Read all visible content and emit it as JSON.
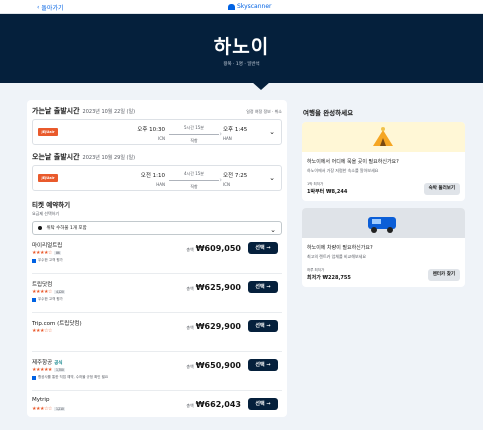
{
  "header": {
    "back_label": "돌아가기",
    "brand": "Skyscanner"
  },
  "hero": {
    "title": "하노이",
    "subtitle": "왕복 · 1명 · 일반석"
  },
  "outbound": {
    "title": "가는날 출발시간",
    "date": "2023년 10월 22일 (일)",
    "note": "일정 여정 정보 · 취소",
    "airline": "JEJUair",
    "dep_time": "오후 10:30",
    "dep_code": "ICN",
    "duration": "5시간 15분",
    "stops": "직항",
    "arr_time": "오후 1:45",
    "arr_code": "HAN"
  },
  "inbound": {
    "title": "오는날 출발시간",
    "date": "2023년 10월 29일 (일)",
    "airline": "JEJUair",
    "dep_time": "오전 1:10",
    "dep_code": "HAN",
    "duration": "4시간 15분",
    "stops": "직항",
    "arr_time": "오전 7:25",
    "arr_code": "ICN"
  },
  "booking": {
    "title": "티켓 예약하기",
    "subtitle": "요금제 선택하기",
    "select_value": "위탁 수하물 1개 포함"
  },
  "agents": [
    {
      "name": "마이리얼트립",
      "stars": "★★★★☆",
      "badge": "86",
      "note": "우수한 고객 평가",
      "price_prefix": "총액",
      "price": "₩609,050",
      "button": "선택 →",
      "tag": ""
    },
    {
      "name": "트립닷컴",
      "stars": "★★★★☆",
      "badge": "4,120",
      "note": "우수한 고객 평가",
      "price_prefix": "총액",
      "price": "₩625,900",
      "button": "선택 →",
      "tag": ""
    },
    {
      "name": "Trip.com (트립닷컴)",
      "stars": "★★★☆☆",
      "badge": "",
      "note": "",
      "price_prefix": "총액",
      "price": "₩629,900",
      "button": "선택 →",
      "tag": ""
    },
    {
      "name": "제주항공",
      "stars": "★★★★★",
      "badge": "1,700",
      "note": "항공사를 통한 직접 예약, 수하물 규정 확인 필요",
      "price_prefix": "총액",
      "price": "₩650,900",
      "button": "선택 →",
      "tag": "공식"
    },
    {
      "name": "Mytrip",
      "stars": "★★★☆☆",
      "badge": "1,210",
      "note": "",
      "price_prefix": "총액",
      "price": "₩662,043",
      "button": "선택 →",
      "tag": ""
    }
  ],
  "sidebar": {
    "title": "여행을 완성하세요",
    "hotel": {
      "heading": "하노이에서 어디에 묵을 곳이 필요하신가요?",
      "sub": "하노이에서 가장 저렴한 숙소를 알아보세요",
      "price_label": "1박 최저가",
      "price": "1박부터 ₩8,244",
      "button": "숙박 둘러보기"
    },
    "car": {
      "heading": "하노이에 차량이 필요하신가요?",
      "sub": "최고의 렌트카 업체를 비교해보세요",
      "price_label": "하루 최저가",
      "price": "최저가 ₩228,755",
      "button": "렌터카 찾기"
    }
  }
}
